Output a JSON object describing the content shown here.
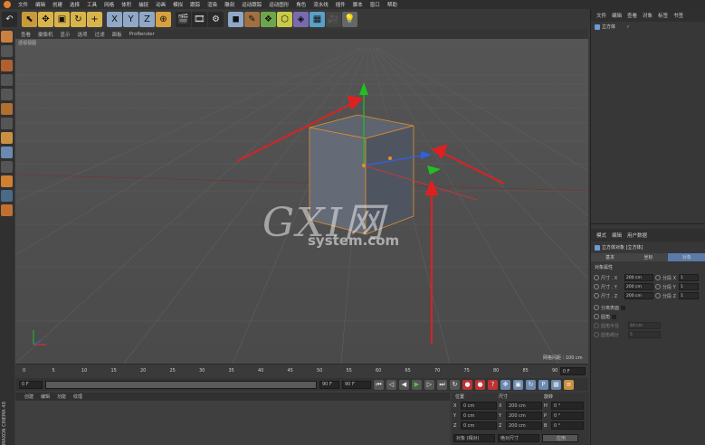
{
  "menu": [
    "文件",
    "编辑",
    "创建",
    "选择",
    "工具",
    "网格",
    "体积",
    "捕捉",
    "动画",
    "模拟",
    "跟踪",
    "渲染",
    "雕刻",
    "运动跟踪",
    "运动图形",
    "角色",
    "流水线",
    "插件",
    "脚本",
    "窗口",
    "帮助"
  ],
  "toolbar_axes": [
    "X",
    "Y",
    "Z"
  ],
  "viewport": {
    "menu": [
      "查看",
      "摄像机",
      "显示",
      "选项",
      "过滤",
      "面板",
      "ProRender"
    ],
    "label": "透视视图",
    "grid_info": "网格间距 : 100 cm"
  },
  "timeline": {
    "ticks": [
      "0",
      "5",
      "10",
      "15",
      "20",
      "25",
      "30",
      "35",
      "40",
      "45",
      "50",
      "55",
      "60",
      "65",
      "70",
      "75",
      "80",
      "85",
      "90"
    ],
    "end_frame": "0 F"
  },
  "transport": {
    "start": "0 F",
    "current": "0 F",
    "range_end": "90 F",
    "end": "90 F"
  },
  "material_menu": [
    "创建",
    "编辑",
    "功能",
    "纹理"
  ],
  "coord": {
    "headers": [
      "位置",
      "尺寸",
      "旋转"
    ],
    "rows": [
      {
        "axis": "X",
        "pos": "0 cm",
        "size": "200 cm",
        "rot_label": "H",
        "rot": "0 °"
      },
      {
        "axis": "Y",
        "pos": "0 cm",
        "size": "200 cm",
        "rot_label": "P",
        "rot": "0 °"
      },
      {
        "axis": "Z",
        "pos": "0 cm",
        "size": "200 cm",
        "rot_label": "B",
        "rot": "0 °"
      }
    ],
    "mode": "对象 (相对)",
    "size_mode": "绝对尺寸",
    "apply": "应用"
  },
  "objects": {
    "tabs": [
      "文件",
      "编辑",
      "查看",
      "对象",
      "标签",
      "书签"
    ],
    "items": [
      "立方体"
    ]
  },
  "attributes": {
    "tabs": [
      "模式",
      "编辑",
      "用户数据"
    ],
    "title": "立方体对象 [立方体]",
    "subtabs": [
      "基本",
      "坐标",
      "对象"
    ],
    "section": "对象属性",
    "rows": [
      {
        "label": "尺寸 . X",
        "value": "200 cm",
        "seg_label": "分段 X",
        "seg": "1"
      },
      {
        "label": "尺寸 . Y",
        "value": "200 cm",
        "seg_label": "分段 Y",
        "seg": "1"
      },
      {
        "label": "尺寸 . Z",
        "value": "200 cm",
        "seg_label": "分段 Z",
        "seg": "1"
      }
    ],
    "separate": "分离表面",
    "fillet": "圆角",
    "fillet_radius_label": "圆角半径",
    "fillet_radius": "40 cm",
    "fillet_sub_label": "圆角细分",
    "fillet_sub": "5"
  },
  "watermark": {
    "logo": "GXI网",
    "domain": "system.com"
  },
  "brand": "MAXON CINEMA 4D",
  "colors": {
    "accent": "#f0a030",
    "arrow": "#e02020",
    "axis_y": "#20c020",
    "axis_x": "#e03030",
    "axis_z": "#3060e0"
  }
}
